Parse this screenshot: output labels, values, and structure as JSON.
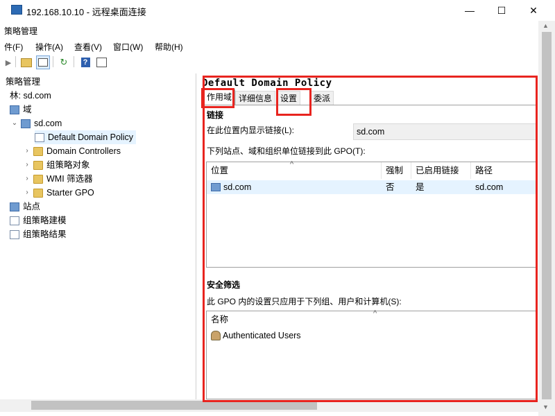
{
  "window": {
    "title": "192.168.10.10 - 远程桌面连接",
    "minimize": "—",
    "maximize": "☐",
    "close": "✕"
  },
  "app": {
    "title": "策略管理"
  },
  "menu": [
    "件(F)",
    "操作(A)",
    "查看(V)",
    "窗口(W)",
    "帮助(H)"
  ],
  "toolbar": {
    "icons": [
      "back-arrow-icon",
      "folder-up-icon",
      "show-hide-console-tree-icon",
      "refresh-icon",
      "help-icon",
      "properties-icon"
    ]
  },
  "tree": {
    "items": [
      {
        "label": "策略管理",
        "level": 0,
        "icon": "gpmc-icon"
      },
      {
        "label": "林: sd.com",
        "level": 0,
        "icon": "forest-icon"
      },
      {
        "label": "域",
        "level": 0,
        "icon": "domain-icon"
      },
      {
        "label": "sd.com",
        "level": 1,
        "icon": "domain-icon",
        "expanded": true
      },
      {
        "label": "Default Domain Policy",
        "level": 2,
        "icon": "gpo-link-icon",
        "selected": true
      },
      {
        "label": "Domain Controllers",
        "level": 2,
        "icon": "ou-folder-icon"
      },
      {
        "label": "组策略对象",
        "level": 2,
        "icon": "folder-icon"
      },
      {
        "label": "WMI 筛选器",
        "level": 2,
        "icon": "folder-icon"
      },
      {
        "label": "Starter GPO",
        "level": 2,
        "icon": "folder-icon"
      },
      {
        "label": "站点",
        "level": 0,
        "icon": "sites-icon"
      },
      {
        "label": "组策略建模",
        "level": 0,
        "icon": "modeling-icon"
      },
      {
        "label": "组策略结果",
        "level": 0,
        "icon": "results-icon"
      }
    ]
  },
  "details": {
    "policy_title": "Default Domain Policy",
    "tabs": [
      "作用域",
      "详细信息",
      "设置",
      "委派"
    ],
    "active_tab": "作用域",
    "links_heading": "链接",
    "display_links_label": "在此位置内显示链接(L):",
    "display_links_value": "sd.com",
    "linked_label": "下列站点、域和组织单位链接到此 GPO(T):",
    "links_table": {
      "columns": [
        "位置",
        "强制",
        "已启用链接",
        "路径"
      ],
      "rows": [
        {
          "location": "sd.com",
          "enforced": "否",
          "enabled": "是",
          "path": "sd.com"
        }
      ]
    },
    "security_heading": "安全筛选",
    "security_label": "此 GPO 内的设置只应用于下列组、用户和计算机(S):",
    "security_table": {
      "columns": [
        "名称"
      ],
      "rows": [
        "Authenticated Users"
      ]
    }
  },
  "colors": {
    "annotation": "#e8241f",
    "selection": "#e5f3ff"
  }
}
